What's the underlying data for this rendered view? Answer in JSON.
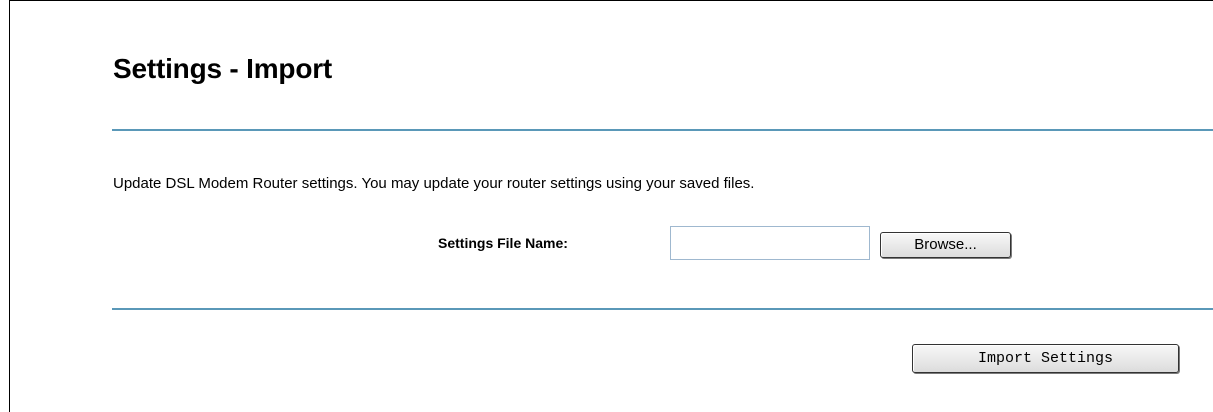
{
  "page": {
    "title": "Settings - Import",
    "description": "Update DSL Modem Router settings. You may update your router settings using your saved files."
  },
  "form": {
    "file_label": "Settings File Name:",
    "file_value": "",
    "browse_label": "Browse...",
    "import_label": "Import Settings"
  },
  "colors": {
    "divider": "#5a98b8",
    "input_border": "#9fb8cf"
  }
}
